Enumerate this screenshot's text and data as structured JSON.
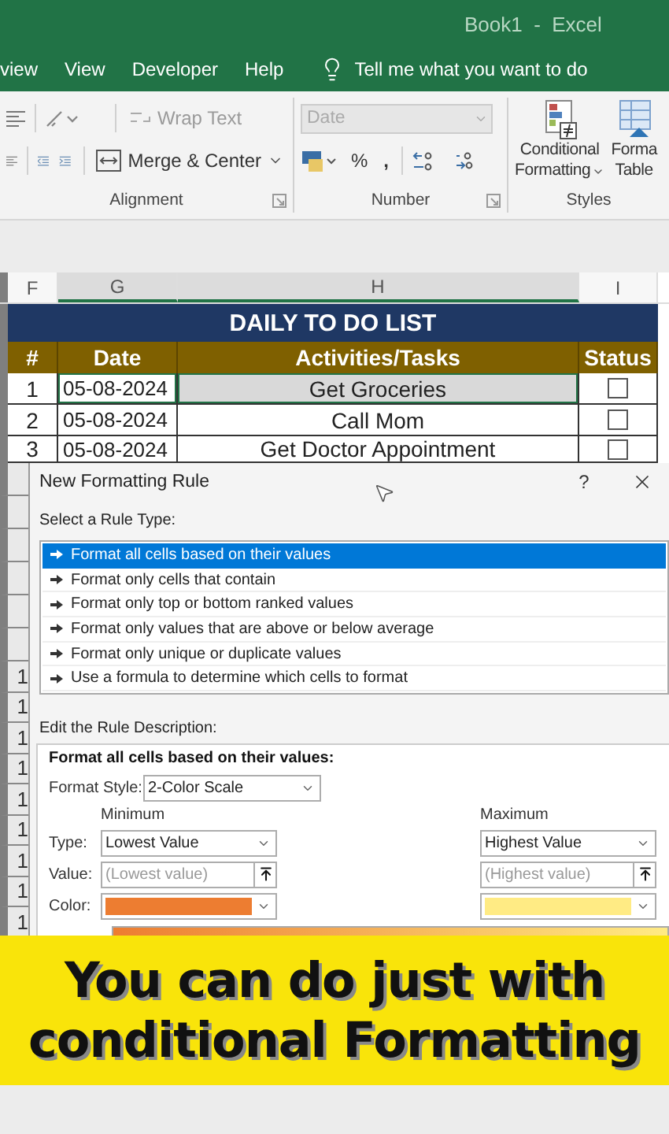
{
  "window": {
    "title": "Book1  -  Excel"
  },
  "ribbon_tabs": [
    {
      "label": "view"
    },
    {
      "label": "View"
    },
    {
      "label": "Developer"
    },
    {
      "label": "Help"
    }
  ],
  "tell_me": {
    "placeholder": "Tell me what you want to do"
  },
  "ribbon": {
    "alignment": {
      "label": "Alignment",
      "wrap_text": {
        "label": "Wrap Text",
        "disabled": true
      },
      "merge_center": {
        "label": "Merge & Center"
      }
    },
    "number": {
      "label": "Number",
      "format": {
        "value": "Date",
        "disabled": true
      },
      "percent": "%",
      "comma": ","
    },
    "styles": {
      "label": "Styles",
      "conditional_formatting": [
        "Conditional",
        "Formatting"
      ],
      "format_as_table": [
        "Forma",
        "Table"
      ]
    }
  },
  "columns": [
    {
      "label": "F",
      "selected": false
    },
    {
      "label": "G",
      "selected": true
    },
    {
      "label": "H",
      "selected": true
    },
    {
      "label": "I",
      "selected": false
    }
  ],
  "sheet": {
    "title": "DAILY TO DO LIST",
    "headers": [
      "#",
      "Date",
      "Activities/Tasks",
      "Status"
    ],
    "rows": [
      {
        "number": "1",
        "date": "05-08-2024",
        "task": "Get Groceries",
        "checked": false,
        "selected": true
      },
      {
        "number": "2",
        "date": "05-08-2024",
        "task": "Call Mom",
        "checked": false,
        "selected": false
      },
      {
        "number": "3",
        "date": "05-08-2024",
        "task": "Get Doctor Appointment",
        "checked": false,
        "selected": false
      }
    ]
  },
  "row_number_stubs": [
    "1",
    "1",
    "1",
    "1",
    "1",
    "1",
    "1",
    "1",
    "1"
  ],
  "dialog": {
    "title": "New Formatting Rule",
    "help": "?",
    "rule_type_label": "Select a Rule Type:",
    "rule_types": [
      {
        "label": "Format all cells based on their values",
        "selected": true
      },
      {
        "label": "Format only cells that contain",
        "selected": false
      },
      {
        "label": "Format only top or bottom ranked values",
        "selected": false
      },
      {
        "label": "Format only values that are above or below average",
        "selected": false
      },
      {
        "label": "Format only unique or duplicate values",
        "selected": false
      },
      {
        "label": "Use a formula to determine which cells to format",
        "selected": false
      }
    ],
    "description_label": "Edit the Rule Description:",
    "description": {
      "heading": "Format all cells based on their values:",
      "format_style": {
        "label": "Format Style:",
        "value": "2-Color Scale"
      },
      "field_labels": [
        "Type:",
        "Value:",
        "Color:"
      ],
      "minimum": {
        "heading": "Minimum",
        "type": "Lowest Value",
        "value_placeholder": "(Lowest value)",
        "color": "#ed7d31"
      },
      "maximum": {
        "heading": "Maximum",
        "type": "Highest Value",
        "value_placeholder": "(Highest value)",
        "color": "#ffeb84"
      }
    }
  },
  "caption": {
    "lines": [
      "You can do just with",
      "conditional Formatting"
    ]
  }
}
